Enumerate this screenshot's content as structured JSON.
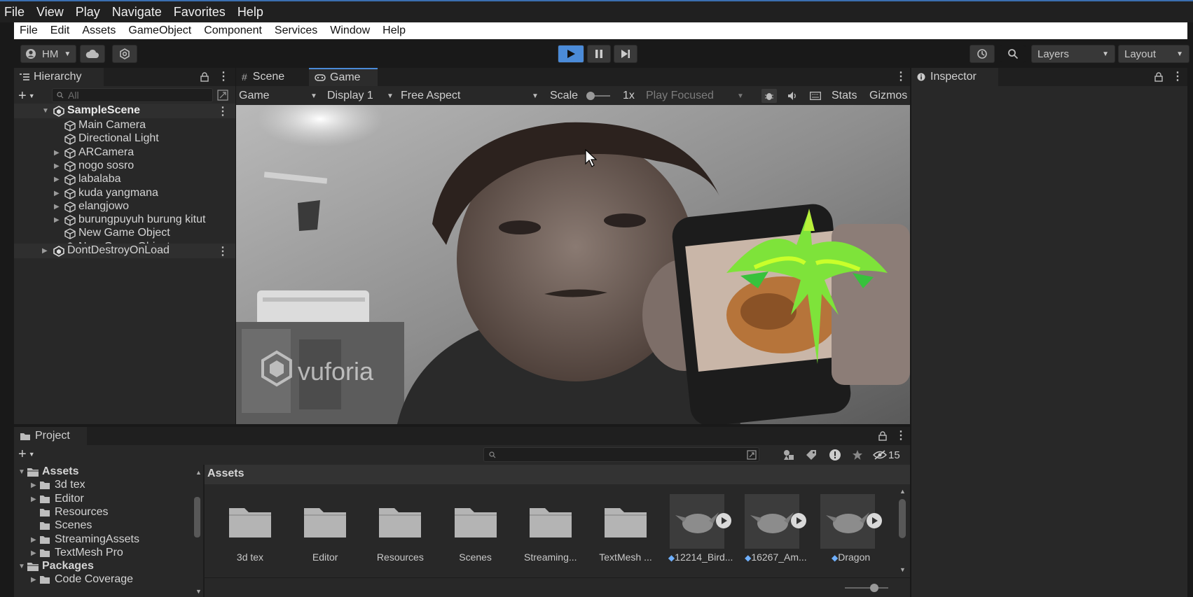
{
  "os_menu": [
    "File",
    "View",
    "Play",
    "Navigate",
    "Favorites",
    "Help"
  ],
  "app_menu": [
    "File",
    "Edit",
    "Assets",
    "GameObject",
    "Component",
    "Services",
    "Window",
    "Help"
  ],
  "toolbar": {
    "account": "HM",
    "layers": "Layers",
    "layout": "Layout"
  },
  "hierarchy": {
    "tab": "Hierarchy",
    "search_placeholder": "All",
    "scene": "SampleScene",
    "items": [
      {
        "label": "Main Camera",
        "expandable": false
      },
      {
        "label": "Directional Light",
        "expandable": false
      },
      {
        "label": "ARCamera",
        "expandable": true
      },
      {
        "label": "nogo sosro",
        "expandable": true
      },
      {
        "label": "labalaba",
        "expandable": true
      },
      {
        "label": "kuda yangmana",
        "expandable": true
      },
      {
        "label": "elangjowo",
        "expandable": true
      },
      {
        "label": "burungpuyuh burung kitut",
        "expandable": true
      },
      {
        "label": "New Game Object",
        "expandable": false
      },
      {
        "label": "New Game Object",
        "expandable": false
      }
    ],
    "dont_destroy": "DontDestroyOnLoad"
  },
  "game_view": {
    "tab_scene": "Scene",
    "tab_game": "Game",
    "mode": "Game",
    "display": "Display 1",
    "aspect": "Free Aspect",
    "scale_label": "Scale",
    "scale_value": "1x",
    "play_focused": "Play Focused",
    "stats": "Stats",
    "gizmos": "Gizmos",
    "watermark": "vuforia"
  },
  "inspector": {
    "tab": "Inspector"
  },
  "project": {
    "tab": "Project",
    "hidden_count": "15",
    "breadcrumb": "Assets",
    "tree": [
      {
        "label": "Assets",
        "level": 0,
        "bold": true
      },
      {
        "label": "3d tex",
        "level": 1,
        "arrow": true
      },
      {
        "label": "Editor",
        "level": 1,
        "arrow": true
      },
      {
        "label": "Resources",
        "level": 1,
        "arrow": false
      },
      {
        "label": "Scenes",
        "level": 1,
        "arrow": false
      },
      {
        "label": "StreamingAssets",
        "level": 1,
        "arrow": true
      },
      {
        "label": "TextMesh Pro",
        "level": 1,
        "arrow": true
      },
      {
        "label": "Packages",
        "level": 0,
        "bold": true
      },
      {
        "label": "Code Coverage",
        "level": 1,
        "arrow": true
      }
    ],
    "assets": [
      {
        "label": "3d tex",
        "kind": "folder"
      },
      {
        "label": "Editor",
        "kind": "folder"
      },
      {
        "label": "Resources",
        "kind": "folder"
      },
      {
        "label": "Scenes",
        "kind": "folder"
      },
      {
        "label": "Streaming...",
        "kind": "folder"
      },
      {
        "label": "TextMesh ...",
        "kind": "folder"
      },
      {
        "label": "12214_Bird...",
        "kind": "model"
      },
      {
        "label": "16267_Am...",
        "kind": "model"
      },
      {
        "label": "Dragon",
        "kind": "model"
      }
    ]
  },
  "colors": {
    "accent": "#4b8bd8",
    "panel": "#282828",
    "bg": "#191919"
  }
}
